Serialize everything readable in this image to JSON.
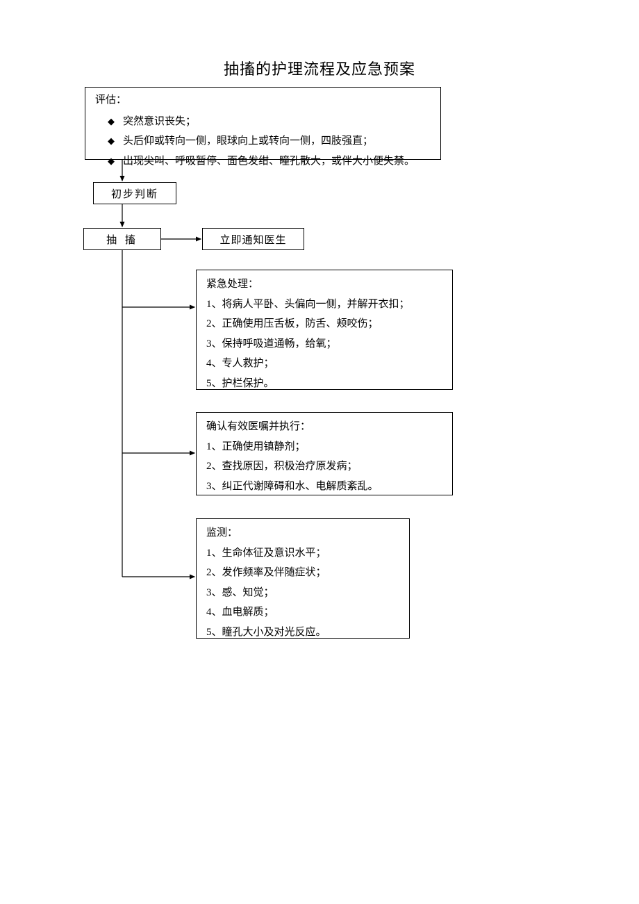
{
  "title": "抽搐的护理流程及应急预案",
  "assess": {
    "label": "评估：",
    "items": [
      "突然意识丧失；",
      "头后仰或转向一侧，眼球向上或转向一侧，四肢强直；",
      "出现尖叫、呼吸暂停、面色发绀、瞳孔散大，或伴大小便失禁。"
    ]
  },
  "judge": "初步判断",
  "seizure": "抽 搐",
  "notify": "立即通知医生",
  "emergency": {
    "label": "紧急处理：",
    "items": [
      "1、将病人平卧、头偏向一侧，并解开衣扣；",
      "2、正确使用压舌板，防舌、颊咬伤；",
      "3、保持呼吸道通畅，给氧；",
      "4、专人救护；",
      "5、护栏保护。"
    ]
  },
  "orders": {
    "label": "确认有效医嘱并执行：",
    "items": [
      "1、正确使用镇静剂；",
      "2、查找原因，积极治疗原发病；",
      "3、纠正代谢障碍和水、电解质紊乱。"
    ]
  },
  "monitor": {
    "label": "监测：",
    "items": [
      "1、生命体征及意识水平；",
      "2、发作频率及伴随症状；",
      "3、感、知觉；",
      "4、血电解质；",
      "5、瞳孔大小及对光反应。"
    ]
  }
}
